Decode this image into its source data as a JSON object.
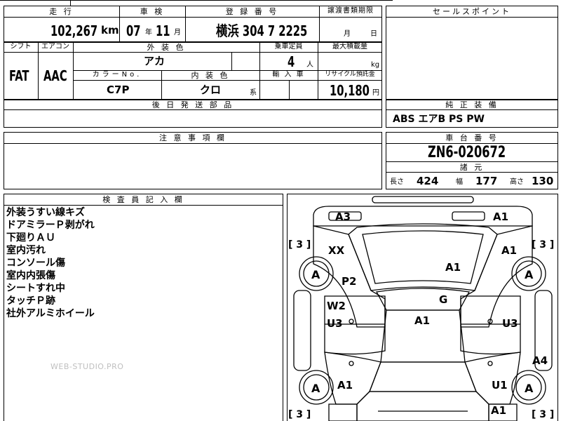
{
  "top_row": {
    "mileage_label": "走 行",
    "mileage_value": "102,267",
    "mileage_unit": "km",
    "inspection_label": "車 検",
    "inspection_year": "07",
    "year_unit": "年",
    "inspection_month": "11",
    "month_unit": "月",
    "registration_label": "登 録 番 号",
    "registration_value": "横浜 304 7 2225",
    "transfer_label": "譲渡書類期限",
    "transfer_month_unit": "月",
    "transfer_day_unit": "日"
  },
  "sales_point": {
    "label": "セールスポイント"
  },
  "spec_row": {
    "shift_label": "シフト",
    "shift_value": "FAT",
    "aircon_label": "エアコン",
    "aircon_value": "AAC",
    "exterior_color_label": "外 装 色",
    "exterior_color_value": "アカ",
    "capacity_label": "乗車定員",
    "capacity_value": "4",
    "capacity_unit": "人",
    "max_load_label": "最大積載量",
    "max_load_unit": "kg",
    "color_no_label": "カラーNo.",
    "color_no_value": "C7P",
    "interior_color_label": "内 装 色",
    "interior_color_value": "クロ",
    "interior_suffix": "系",
    "import_label": "輸 入 車",
    "recycle_label": "リサイクル預託金",
    "recycle_value": "10,180",
    "recycle_unit": "円"
  },
  "later_parts": {
    "label": "後 日 発 送 部 品"
  },
  "genuine_equipment": {
    "label": "純 正 装 備",
    "value": "ABS エアB PS PW"
  },
  "caution": {
    "label": "注 意 事 項 欄"
  },
  "chassis": {
    "label": "車 台 番 号",
    "value": "ZN6-020672",
    "specs_label": "諸 元",
    "length_label": "長さ",
    "length_value": "424",
    "width_label": "幅",
    "width_value": "177",
    "height_label": "高さ",
    "height_value": "130"
  },
  "inspector": {
    "label": "検 査 員 記 入 欄",
    "notes": [
      "外装うすい線キズ",
      "ドアミラーＰ剥がれ",
      "下廻りＡＵ",
      "室内汚れ",
      "コンソール傷",
      "室内内張傷",
      "シートすれ中",
      "タッチＰ跡",
      "社外アルミホイール"
    ],
    "watermark": "WEB-STUDIO.PRO"
  },
  "diagram": {
    "tire_marks": [
      "[ 3 ]",
      "[ 3 ]",
      "[ 3 ]",
      "[ 3 ]"
    ],
    "wheel_marks": [
      "A",
      "A",
      "A",
      "A"
    ],
    "damage": {
      "front_bumper_left": "A3",
      "front_bumper_right": "A1",
      "front_fender_left": "XX",
      "front_fender_right": "A1",
      "hood": "A1",
      "pillar_left": "P2",
      "front_door_left": "W2",
      "front_door_left_under": "U3",
      "glass": "G",
      "roof": "A1",
      "front_door_right_under": "U3",
      "rear_quarter_right": "A4",
      "rear_fender_left": "A1",
      "rear_fender_right": "U1",
      "rear_bumper_right": "A1"
    }
  }
}
